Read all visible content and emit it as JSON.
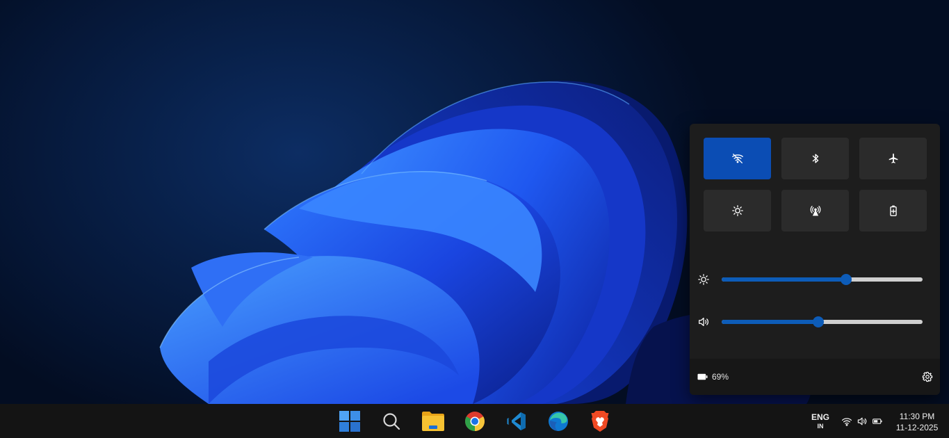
{
  "quick_settings": {
    "tiles": [
      {
        "id": "wifi",
        "icon": "wifi-off-icon",
        "active": true
      },
      {
        "id": "bluetooth",
        "icon": "bluetooth-icon",
        "active": false
      },
      {
        "id": "airplane-mode",
        "icon": "airplane-icon",
        "active": false
      },
      {
        "id": "night-light",
        "icon": "brightness-icon",
        "active": false
      },
      {
        "id": "mobile-hotspot",
        "icon": "hotspot-icon",
        "active": false
      },
      {
        "id": "battery-saver",
        "icon": "battery-saver-icon",
        "active": false
      }
    ],
    "brightness": {
      "icon": "brightness-icon",
      "value_percent": 62
    },
    "volume": {
      "icon": "speaker-icon",
      "value_percent": 48
    },
    "battery": {
      "icon": "battery-icon",
      "label": "69%"
    },
    "settings_icon": "gear-icon"
  },
  "taskbar": {
    "apps": [
      {
        "id": "start",
        "icon": "windows-start-icon"
      },
      {
        "id": "search",
        "icon": "search-icon"
      },
      {
        "id": "file-explorer",
        "icon": "folder-icon"
      },
      {
        "id": "chrome",
        "icon": "chrome-icon"
      },
      {
        "id": "vscode",
        "icon": "vscode-icon"
      },
      {
        "id": "edge",
        "icon": "edge-icon"
      },
      {
        "id": "brave",
        "icon": "brave-icon"
      }
    ],
    "language": {
      "primary": "ENG",
      "region": "IN"
    },
    "tray": [
      "wifi-icon",
      "speaker-icon",
      "battery-icon"
    ],
    "clock": {
      "time": "11:30 PM",
      "date": "11-12-2025"
    }
  },
  "colors": {
    "accent": "#0b4db4",
    "slider_fill": "#0d5cb8",
    "panel_bg": "#1d1d1d",
    "taskbar_bg": "#141414"
  }
}
